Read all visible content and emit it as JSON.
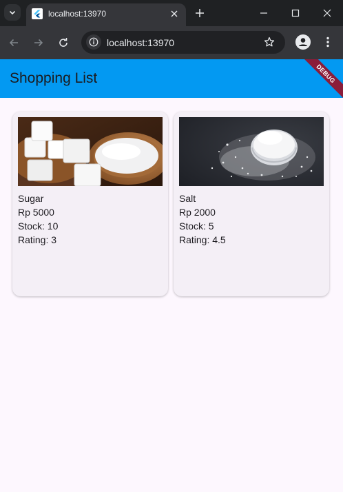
{
  "browser": {
    "tab_title": "localhost:13970",
    "url": "localhost:13970"
  },
  "app": {
    "title": "Shopping List",
    "debug_banner": "DEBUG"
  },
  "products": [
    {
      "name": "Sugar",
      "price": "Rp 5000",
      "stock": "Stock: 10",
      "rating": "Rating: 3"
    },
    {
      "name": "Salt",
      "price": "Rp 2000",
      "stock": "Stock: 5",
      "rating": "Rating: 4.5"
    }
  ],
  "colors": {
    "app_bar": "#0399f2",
    "background": "#fdf7fe",
    "card": "#f4eff6",
    "debug_ribbon": "#8b1d3a"
  },
  "icons": {
    "tab_search": "chevron-down-icon",
    "favicon": "flutter-icon",
    "tab_close": "close-icon",
    "new_tab": "plus-icon",
    "back": "arrow-left-icon",
    "forward": "arrow-right-icon",
    "reload": "reload-icon",
    "site_info": "info-icon",
    "bookmark": "star-icon",
    "profile": "person-icon",
    "menu": "more-vert-icon"
  }
}
